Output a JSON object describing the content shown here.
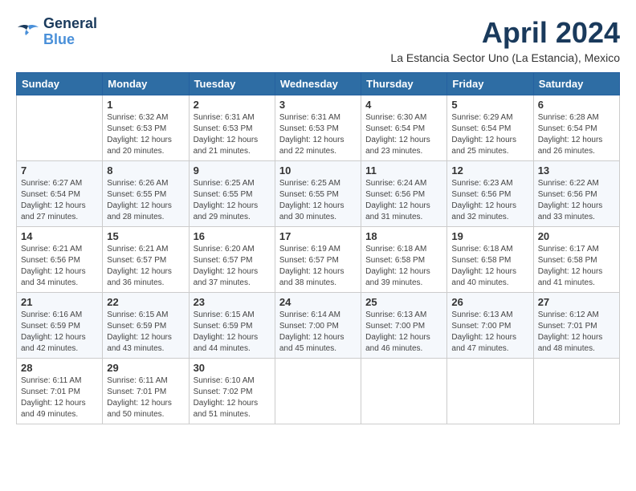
{
  "logo": {
    "line1": "General",
    "line2": "Blue"
  },
  "title": "April 2024",
  "subtitle": "La Estancia Sector Uno (La Estancia), Mexico",
  "days_of_week": [
    "Sunday",
    "Monday",
    "Tuesday",
    "Wednesday",
    "Thursday",
    "Friday",
    "Saturday"
  ],
  "weeks": [
    [
      {
        "day": "",
        "info": ""
      },
      {
        "day": "1",
        "info": "Sunrise: 6:32 AM\nSunset: 6:53 PM\nDaylight: 12 hours\nand 20 minutes."
      },
      {
        "day": "2",
        "info": "Sunrise: 6:31 AM\nSunset: 6:53 PM\nDaylight: 12 hours\nand 21 minutes."
      },
      {
        "day": "3",
        "info": "Sunrise: 6:31 AM\nSunset: 6:53 PM\nDaylight: 12 hours\nand 22 minutes."
      },
      {
        "day": "4",
        "info": "Sunrise: 6:30 AM\nSunset: 6:54 PM\nDaylight: 12 hours\nand 23 minutes."
      },
      {
        "day": "5",
        "info": "Sunrise: 6:29 AM\nSunset: 6:54 PM\nDaylight: 12 hours\nand 25 minutes."
      },
      {
        "day": "6",
        "info": "Sunrise: 6:28 AM\nSunset: 6:54 PM\nDaylight: 12 hours\nand 26 minutes."
      }
    ],
    [
      {
        "day": "7",
        "info": "Sunrise: 6:27 AM\nSunset: 6:54 PM\nDaylight: 12 hours\nand 27 minutes."
      },
      {
        "day": "8",
        "info": "Sunrise: 6:26 AM\nSunset: 6:55 PM\nDaylight: 12 hours\nand 28 minutes."
      },
      {
        "day": "9",
        "info": "Sunrise: 6:25 AM\nSunset: 6:55 PM\nDaylight: 12 hours\nand 29 minutes."
      },
      {
        "day": "10",
        "info": "Sunrise: 6:25 AM\nSunset: 6:55 PM\nDaylight: 12 hours\nand 30 minutes."
      },
      {
        "day": "11",
        "info": "Sunrise: 6:24 AM\nSunset: 6:56 PM\nDaylight: 12 hours\nand 31 minutes."
      },
      {
        "day": "12",
        "info": "Sunrise: 6:23 AM\nSunset: 6:56 PM\nDaylight: 12 hours\nand 32 minutes."
      },
      {
        "day": "13",
        "info": "Sunrise: 6:22 AM\nSunset: 6:56 PM\nDaylight: 12 hours\nand 33 minutes."
      }
    ],
    [
      {
        "day": "14",
        "info": "Sunrise: 6:21 AM\nSunset: 6:56 PM\nDaylight: 12 hours\nand 34 minutes."
      },
      {
        "day": "15",
        "info": "Sunrise: 6:21 AM\nSunset: 6:57 PM\nDaylight: 12 hours\nand 36 minutes."
      },
      {
        "day": "16",
        "info": "Sunrise: 6:20 AM\nSunset: 6:57 PM\nDaylight: 12 hours\nand 37 minutes."
      },
      {
        "day": "17",
        "info": "Sunrise: 6:19 AM\nSunset: 6:57 PM\nDaylight: 12 hours\nand 38 minutes."
      },
      {
        "day": "18",
        "info": "Sunrise: 6:18 AM\nSunset: 6:58 PM\nDaylight: 12 hours\nand 39 minutes."
      },
      {
        "day": "19",
        "info": "Sunrise: 6:18 AM\nSunset: 6:58 PM\nDaylight: 12 hours\nand 40 minutes."
      },
      {
        "day": "20",
        "info": "Sunrise: 6:17 AM\nSunset: 6:58 PM\nDaylight: 12 hours\nand 41 minutes."
      }
    ],
    [
      {
        "day": "21",
        "info": "Sunrise: 6:16 AM\nSunset: 6:59 PM\nDaylight: 12 hours\nand 42 minutes."
      },
      {
        "day": "22",
        "info": "Sunrise: 6:15 AM\nSunset: 6:59 PM\nDaylight: 12 hours\nand 43 minutes."
      },
      {
        "day": "23",
        "info": "Sunrise: 6:15 AM\nSunset: 6:59 PM\nDaylight: 12 hours\nand 44 minutes."
      },
      {
        "day": "24",
        "info": "Sunrise: 6:14 AM\nSunset: 7:00 PM\nDaylight: 12 hours\nand 45 minutes."
      },
      {
        "day": "25",
        "info": "Sunrise: 6:13 AM\nSunset: 7:00 PM\nDaylight: 12 hours\nand 46 minutes."
      },
      {
        "day": "26",
        "info": "Sunrise: 6:13 AM\nSunset: 7:00 PM\nDaylight: 12 hours\nand 47 minutes."
      },
      {
        "day": "27",
        "info": "Sunrise: 6:12 AM\nSunset: 7:01 PM\nDaylight: 12 hours\nand 48 minutes."
      }
    ],
    [
      {
        "day": "28",
        "info": "Sunrise: 6:11 AM\nSunset: 7:01 PM\nDaylight: 12 hours\nand 49 minutes."
      },
      {
        "day": "29",
        "info": "Sunrise: 6:11 AM\nSunset: 7:01 PM\nDaylight: 12 hours\nand 50 minutes."
      },
      {
        "day": "30",
        "info": "Sunrise: 6:10 AM\nSunset: 7:02 PM\nDaylight: 12 hours\nand 51 minutes."
      },
      {
        "day": "",
        "info": ""
      },
      {
        "day": "",
        "info": ""
      },
      {
        "day": "",
        "info": ""
      },
      {
        "day": "",
        "info": ""
      }
    ]
  ]
}
